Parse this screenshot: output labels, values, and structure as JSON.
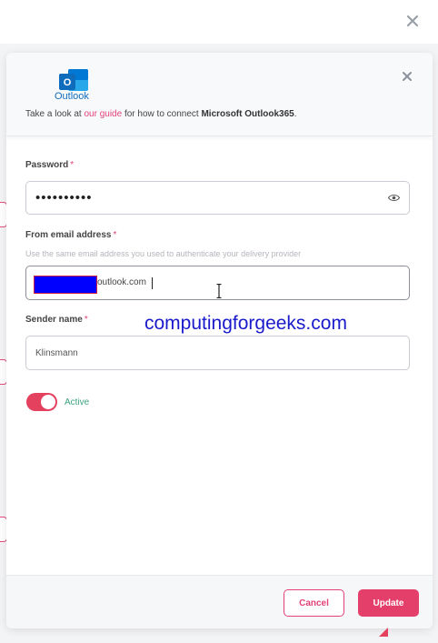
{
  "banner": {
    "logo_text": "Outlook",
    "text_before": "Take a look at ",
    "link_text": "our guide",
    "text_middle": " for how to connect ",
    "text_bold": "Microsoft Outlook365",
    "text_after": "."
  },
  "form": {
    "password": {
      "label": "Password",
      "required_mark": "*",
      "value_masked": "••••••••••"
    },
    "from_email": {
      "label": "From email address",
      "required_mark": "*",
      "hint": "Use the same email address you used to authenticate your delivery provider",
      "visible_value": "outlook.com"
    },
    "sender_name": {
      "label": "Sender name",
      "required_mark": "*",
      "value": "Klinsmann"
    },
    "active_toggle": {
      "label": "Active",
      "on": true
    }
  },
  "watermark": "computingforgeeks.com",
  "footer": {
    "cancel_label": "Cancel",
    "update_label": "Update"
  },
  "icons": {
    "close": "close-icon",
    "eye": "eye-icon",
    "logo": "outlook-logo-icon"
  },
  "colors": {
    "accent": "#e43f6a",
    "link": "#e4417a",
    "active_text": "#3aa37d",
    "outlook_blue": "#0f6cbd"
  }
}
